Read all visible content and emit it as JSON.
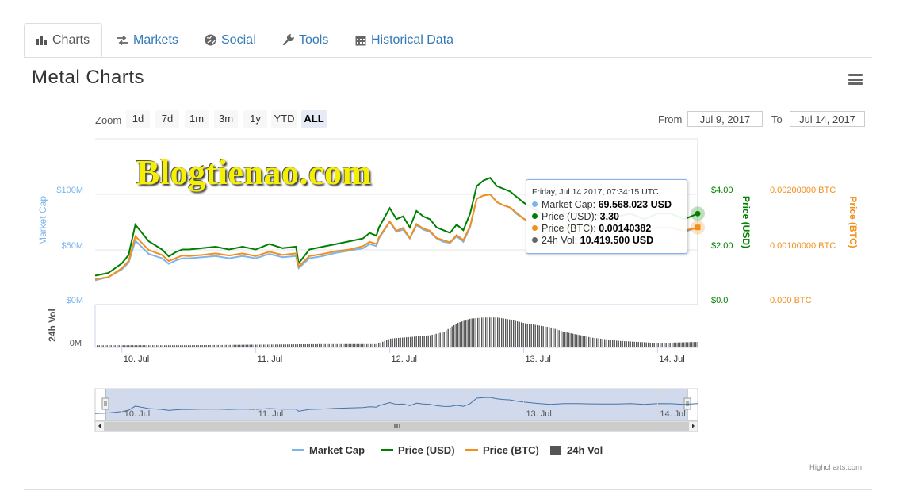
{
  "tabs": [
    {
      "label": "Charts",
      "icon": "bar-chart-icon",
      "active": true
    },
    {
      "label": "Markets",
      "icon": "exchange-arrows-icon",
      "active": false
    },
    {
      "label": "Social",
      "icon": "globe-icon",
      "active": false
    },
    {
      "label": "Tools",
      "icon": "wrench-icon",
      "active": false
    },
    {
      "label": "Historical Data",
      "icon": "calendar-icon",
      "active": false
    }
  ],
  "page_title": "Metal Charts",
  "zoom": {
    "label": "Zoom",
    "buttons": [
      "1d",
      "7d",
      "1m",
      "3m",
      "1y",
      "YTD",
      "ALL"
    ],
    "selected": "ALL"
  },
  "range": {
    "from_label": "From",
    "from_value": "Jul 9, 2017",
    "to_label": "To",
    "to_value": "Jul 14, 2017"
  },
  "watermark": "Blogtienao.com",
  "tooltip": {
    "header": "Friday, Jul 14 2017, 07:34:15 UTC",
    "rows": [
      {
        "label": "Market Cap:",
        "value": "69.568.023 USD",
        "color": "#7cb5ec"
      },
      {
        "label": "Price (USD):",
        "value": "3.30",
        "color": "#008000"
      },
      {
        "label": "Price (BTC):",
        "value": "0.00140382",
        "color": "#f28f1c"
      },
      {
        "label": "24h Vol:",
        "value": "10.419.500 USD",
        "color": "#666666"
      }
    ]
  },
  "legend": [
    {
      "label": "Market Cap",
      "color": "#7cb5ec",
      "kind": "line"
    },
    {
      "label": "Price (USD)",
      "color": "#008000",
      "kind": "line"
    },
    {
      "label": "Price (BTC)",
      "color": "#f28f1c",
      "kind": "line"
    },
    {
      "label": "24h Vol",
      "color": "#555555",
      "kind": "box"
    }
  ],
  "credits": "Highcharts.com",
  "chart_data": {
    "type": "line",
    "x_axis": {
      "ticks": [
        "10. Jul",
        "11. Jul",
        "12. Jul",
        "13. Jul",
        "14. Jul"
      ]
    },
    "y_axes": [
      {
        "label": "Market Cap",
        "ticks": [
          "$0M",
          "$50M",
          "$100M"
        ],
        "range": [
          0,
          100
        ],
        "unit": "$M",
        "color": "#7cb5ec"
      },
      {
        "label": "Price (USD)",
        "ticks": [
          "$0.0",
          "$2.00",
          "$4.00"
        ],
        "range": [
          0,
          4
        ],
        "color": "#008000"
      },
      {
        "label": "Price (BTC)",
        "ticks": [
          "0.000 BTC",
          "0.00100000 BTC",
          "0.00200000 BTC"
        ],
        "range": [
          0,
          0.002
        ],
        "color": "#f28f1c"
      },
      {
        "label": "24h Vol",
        "ticks": [
          "0M"
        ],
        "color": "#555555"
      }
    ],
    "x": [
      9.8,
      9.9,
      10.0,
      10.05,
      10.1,
      10.2,
      10.3,
      10.35,
      10.4,
      10.45,
      10.5,
      10.6,
      10.7,
      10.8,
      10.9,
      11.0,
      11.1,
      11.2,
      11.3,
      11.32,
      11.4,
      11.5,
      11.6,
      11.7,
      11.8,
      11.85,
      11.9,
      11.92,
      12.0,
      12.05,
      12.1,
      12.15,
      12.2,
      12.25,
      12.3,
      12.35,
      12.4,
      12.45,
      12.5,
      12.55,
      12.6,
      12.65,
      12.7,
      12.75,
      12.8,
      12.85,
      12.9,
      12.95,
      13.0,
      13.1,
      13.2,
      13.3,
      13.4,
      13.5,
      13.6,
      13.7,
      13.8,
      13.9,
      14.0,
      14.1,
      14.2,
      14.3
    ],
    "series": [
      {
        "name": "Price (USD)",
        "color": "#008000",
        "values": [
          1.05,
          1.15,
          1.5,
          1.8,
          2.9,
          2.3,
          2.0,
          1.75,
          1.9,
          2.0,
          2.0,
          2.05,
          2.1,
          2.0,
          2.1,
          2.0,
          2.2,
          2.05,
          2.1,
          1.5,
          2.0,
          2.1,
          2.2,
          2.3,
          2.4,
          2.6,
          2.5,
          2.8,
          3.5,
          3.1,
          3.2,
          2.8,
          3.4,
          3.2,
          3.1,
          2.8,
          2.7,
          2.6,
          2.9,
          2.7,
          3.3,
          4.3,
          4.5,
          4.6,
          4.3,
          4.2,
          4.1,
          3.9,
          3.7,
          3.4,
          3.1,
          3.3,
          3.3,
          3.3,
          3.2,
          3.2,
          3.3,
          3.1,
          3.3,
          3.3,
          3.1,
          3.3
        ]
      },
      {
        "name": "Market Cap",
        "color": "#7cb5ec",
        "values": [
          22,
          25,
          32,
          38,
          58,
          46,
          42,
          37,
          40,
          42,
          42,
          43,
          44,
          42,
          44,
          42,
          46,
          43,
          44,
          33,
          42,
          44,
          47,
          49,
          51,
          55,
          53,
          60,
          75,
          66,
          68,
          60,
          72,
          68,
          66,
          60,
          57,
          56,
          62,
          57,
          70,
          96,
          99,
          100,
          93,
          90,
          88,
          82,
          78,
          71,
          66,
          70,
          70,
          69,
          68,
          68,
          70,
          66,
          70,
          69.6,
          66,
          70
        ]
      },
      {
        "name": "Price (BTC)",
        "color": "#f28f1c",
        "values": [
          0.00046,
          0.0005,
          0.00066,
          0.00079,
          0.00124,
          0.00099,
          0.0009,
          0.00079,
          0.00084,
          0.00089,
          0.00088,
          0.0009,
          0.00093,
          0.00089,
          0.00093,
          0.00088,
          0.00096,
          0.0009,
          0.00093,
          0.00069,
          0.00088,
          0.00092,
          0.00097,
          0.001,
          0.00106,
          0.00114,
          0.0011,
          0.00122,
          0.00151,
          0.00134,
          0.00139,
          0.00121,
          0.00146,
          0.00138,
          0.00134,
          0.00121,
          0.00117,
          0.00113,
          0.00126,
          0.00117,
          0.00142,
          0.00192,
          0.00198,
          0.002,
          0.00186,
          0.0018,
          0.00176,
          0.00166,
          0.00156,
          0.00142,
          0.00132,
          0.00142,
          0.00141,
          0.0014,
          0.00138,
          0.00138,
          0.00141,
          0.00133,
          0.0014,
          0.0014,
          0.00134,
          0.0014
        ]
      }
    ],
    "volume": {
      "name": "24h Vol",
      "x": [
        9.8,
        10.5,
        11.5,
        11.9,
        12.0,
        12.2,
        12.3,
        12.4,
        12.5,
        12.6,
        12.7,
        12.8,
        12.9,
        13.0,
        13.1,
        13.2,
        13.3,
        13.5,
        13.7,
        14.0,
        14.3
      ],
      "values": [
        2,
        2,
        3,
        3,
        8,
        10,
        11,
        14,
        22,
        26,
        27,
        27,
        25,
        22,
        20,
        18,
        14,
        9,
        6,
        4,
        5
      ]
    },
    "tooltip_x": 14.3,
    "navigator": {
      "ticks": [
        "10. Jul",
        "11. Jul",
        "13. Jul",
        "14. Jul"
      ]
    }
  }
}
